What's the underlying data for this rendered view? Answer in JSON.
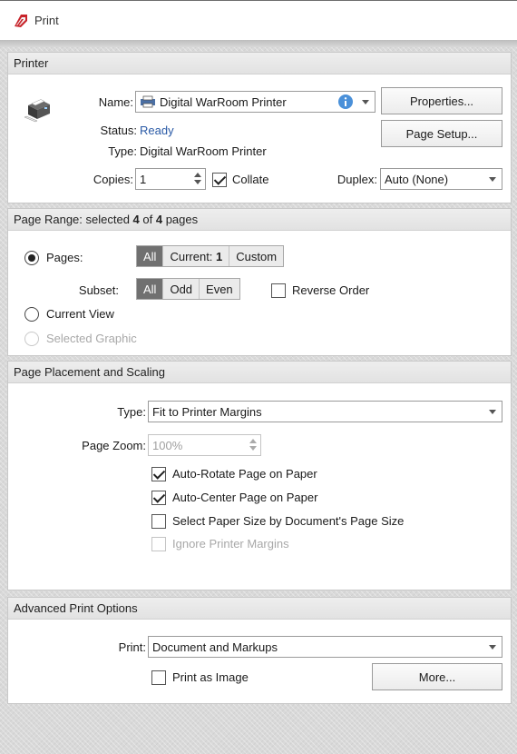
{
  "window": {
    "title": "Print"
  },
  "printer": {
    "header": "Printer",
    "name_label": "Name:",
    "name_value": "Digital WarRoom Printer",
    "properties_button": "Properties...",
    "page_setup_button": "Page Setup...",
    "status_label": "Status:",
    "status_value": "Ready",
    "type_label": "Type:",
    "type_value": "Digital WarRoom Printer",
    "copies_label": "Copies:",
    "copies_value": "1",
    "collate_label": "Collate",
    "collate_checked": true,
    "duplex_label": "Duplex:",
    "duplex_value": "Auto (None)"
  },
  "page_range": {
    "header_prefix": "Page Range: selected ",
    "selected_count": "4",
    "header_mid": " of ",
    "total_count": "4",
    "header_suffix": " pages",
    "pages_label": "Pages:",
    "pages_seg": {
      "all": "All",
      "current_label": "Current: ",
      "current_value": "1",
      "custom": "Custom"
    },
    "subset_label": "Subset:",
    "subset_seg": {
      "all": "All",
      "odd": "Odd",
      "even": "Even"
    },
    "reverse_order_label": "Reverse Order",
    "current_view_label": "Current View",
    "selected_graphic_label": "Selected Graphic"
  },
  "placement": {
    "header": "Page Placement and Scaling",
    "type_label": "Type:",
    "type_value": "Fit to Printer Margins",
    "zoom_label": "Page Zoom:",
    "zoom_value": "100%",
    "auto_rotate_label": "Auto-Rotate Page on Paper",
    "auto_center_label": "Auto-Center Page on Paper",
    "select_paper_label": "Select Paper Size by Document's Page Size",
    "ignore_margins_label": "Ignore Printer Margins"
  },
  "advanced": {
    "header": "Advanced Print Options",
    "print_label": "Print:",
    "print_value": "Document and Markups",
    "print_as_image_label": "Print as Image",
    "more_button": "More..."
  },
  "icons": {
    "app_logo": "app-logo-icon",
    "printer": "printer-icon",
    "info": "info-icon",
    "info_color": "#4a90d9"
  }
}
